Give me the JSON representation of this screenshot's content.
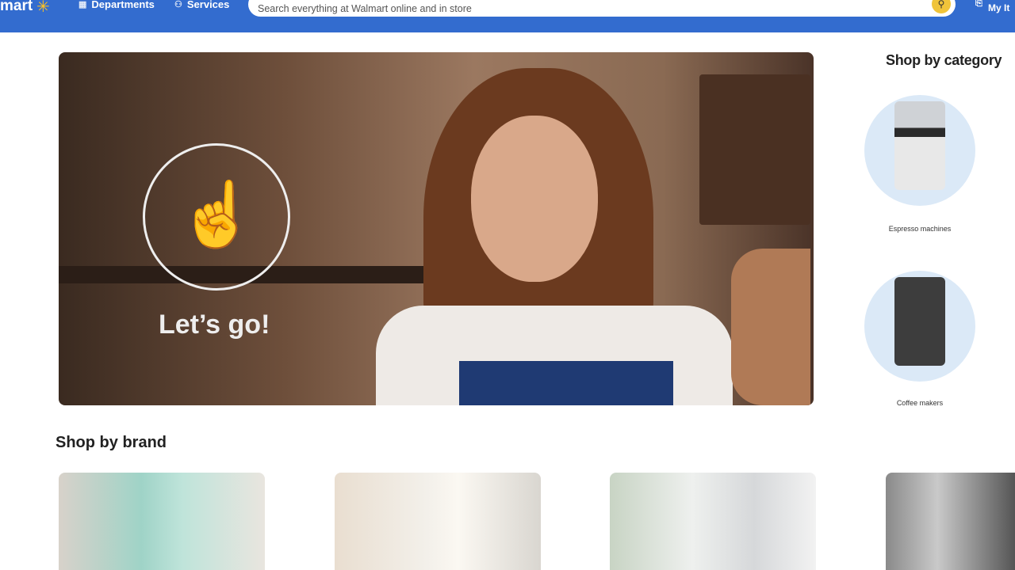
{
  "header": {
    "logo_text": "mart",
    "departments": "Departments",
    "services": "Services",
    "search_placeholder": "Search everything at Walmart online and in store",
    "my_items": "My It"
  },
  "video": {
    "overlay_text": "Let’s go!",
    "icon": "tap-hand-icon"
  },
  "categories": {
    "title": "Shop by category",
    "items": [
      {
        "label": "Espresso machines"
      },
      {
        "label": "Coffee makers"
      }
    ]
  },
  "brands": {
    "title": "Shop by brand",
    "count_visible": 4
  },
  "colors": {
    "header": "#336ccf",
    "spark": "#ffc220",
    "search_button": "#f0c43a"
  }
}
